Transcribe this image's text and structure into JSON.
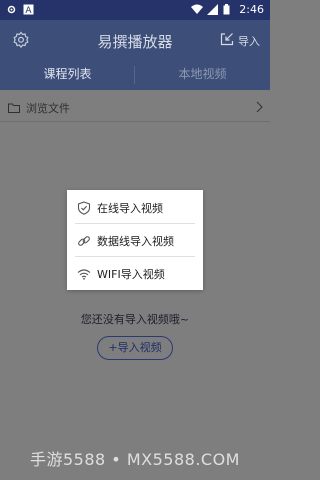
{
  "status_bar": {
    "time": "2:46",
    "left_icons": [
      "settings-notification-icon",
      "font-notification-icon"
    ],
    "right_icons": [
      "wifi-icon",
      "cellular-signal-icon",
      "battery-icon"
    ]
  },
  "app_bar": {
    "title": "易撰播放器",
    "import_label": "导入"
  },
  "tabs": [
    {
      "label": "课程列表",
      "active": true
    },
    {
      "label": "本地视频",
      "active": false
    }
  ],
  "browse": {
    "label": "浏览文件"
  },
  "empty_state": {
    "message": "您还没有导入视频哦~",
    "button_label": "+导入视频"
  },
  "import_menu": {
    "items": [
      {
        "label": "在线导入视频",
        "icon": "shield-check-icon"
      },
      {
        "label": "数据线导入视频",
        "icon": "link-icon"
      },
      {
        "label": "WIFI导入视频",
        "icon": "wifi-icon"
      }
    ]
  },
  "watermark": "手游5588 • MX5588.COM",
  "colors": {
    "primary": "#3d4f79",
    "status_bar": "#25336a",
    "scrim_background": "#7e7e7e"
  }
}
